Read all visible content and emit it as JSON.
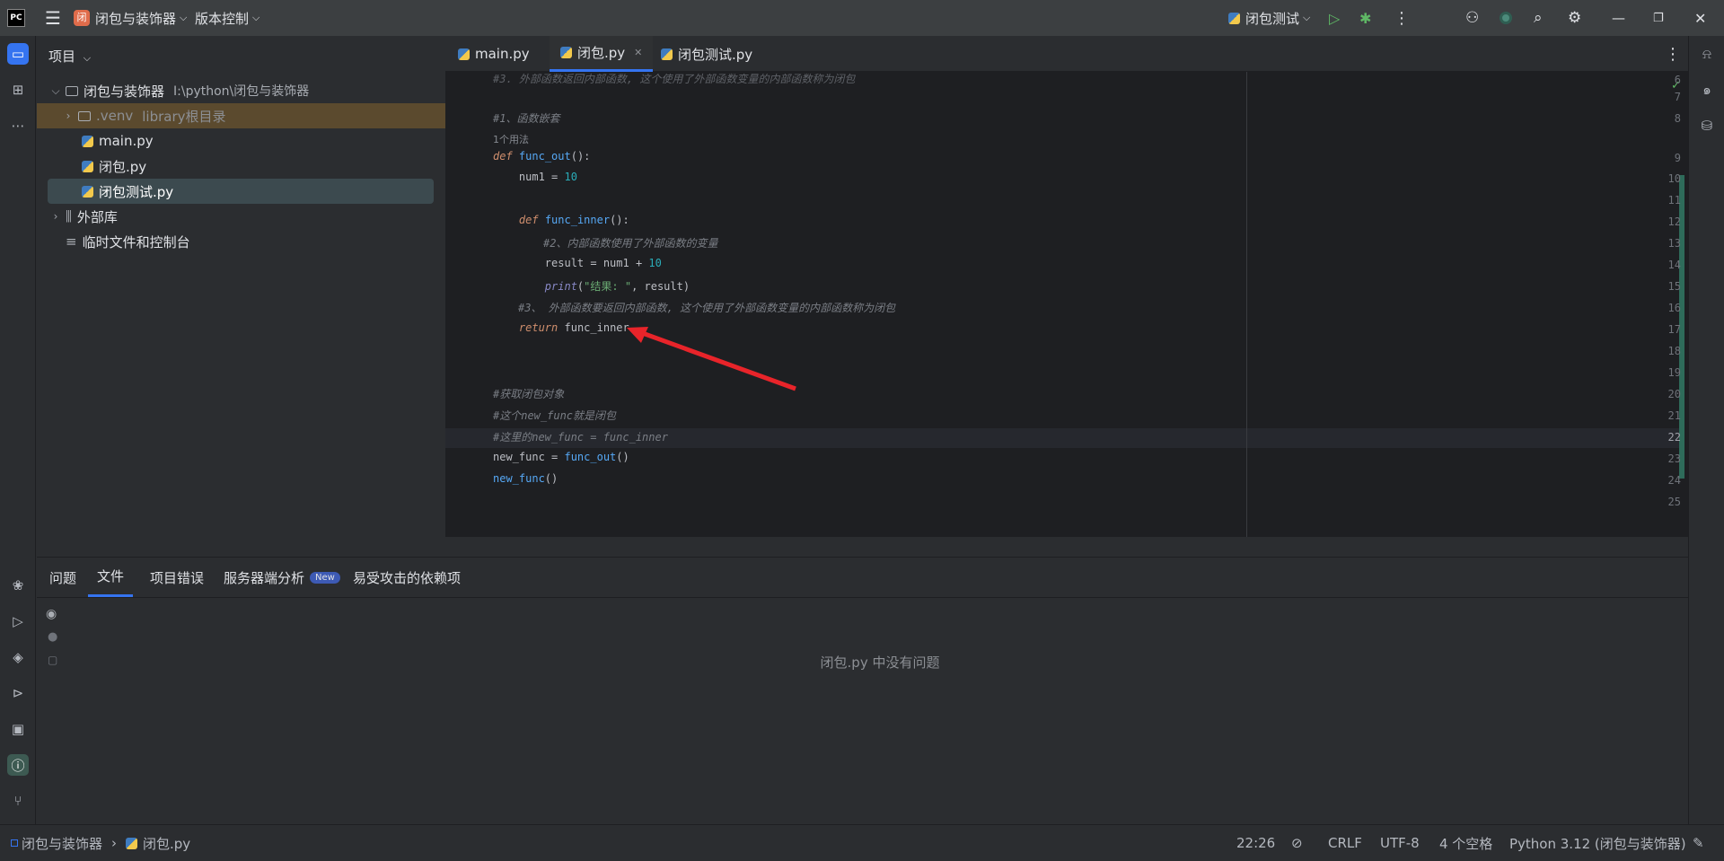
{
  "titlebar": {
    "logo": "PC",
    "project_badge": "闭",
    "project_name": "闭包与装饰器",
    "vcs": "版本控制",
    "run_config": "闭包测试",
    "accent": "#e06c4b"
  },
  "project_panel": {
    "title": "项目",
    "tree": [
      {
        "label": "闭包与装饰器",
        "extra": "I:\\python\\闭包与装饰器",
        "type": "folder"
      },
      {
        "label": ".venv",
        "extra": "library根目录",
        "type": "folder"
      },
      {
        "label": "main.py",
        "type": "py"
      },
      {
        "label": "闭包.py",
        "type": "py"
      },
      {
        "label": "闭包测试.py",
        "type": "py"
      },
      {
        "label": "外部库",
        "type": "lib"
      },
      {
        "label": "临时文件和控制台",
        "type": "scratch"
      }
    ]
  },
  "editor_tabs": [
    {
      "label": "main.py"
    },
    {
      "label": "闭包.py",
      "active": true
    },
    {
      "label": "闭包测试.py"
    }
  ],
  "code": {
    "top_partial": "#3. 外部函数返回内部函数, 这个使用了外部函数变量的内部函数称为闭包",
    "usage_hint": "1个用法",
    "line_numbers": [
      "6",
      "7",
      "8",
      "9",
      "10",
      "11",
      "12",
      "13",
      "14",
      "15",
      "16",
      "17",
      "18",
      "19",
      "20",
      "21",
      "22",
      "23",
      "24",
      "25"
    ],
    "comment1": "#1、函数嵌套",
    "comment2": "#2、内部函数使用了外部函数的变量",
    "str_result": "\"结果: \"",
    "comment3": "#3、 外部函数要返回内部函数, 这个使用了外部函数变量的内部函数称为闭包",
    "comment4": "#获取闭包对象",
    "comment5": "#这个new_func就是闭包",
    "comment6": "#这里的new_func = func_inner"
  },
  "bottom_panel": {
    "tabs": [
      "问题",
      "文件",
      "项目错误",
      "服务器端分析",
      "易受攻击的依赖项"
    ],
    "new_badge": "New",
    "empty_message": "闭包.py 中没有问题"
  },
  "statusbar": {
    "breadcrumb_project": "闭包与装饰器",
    "breadcrumb_file": "闭包.py",
    "position": "22:26",
    "line_sep": "CRLF",
    "encoding": "UTF-8",
    "indent": "4 个空格",
    "interpreter": "Python 3.12 (闭包与装饰器)"
  }
}
